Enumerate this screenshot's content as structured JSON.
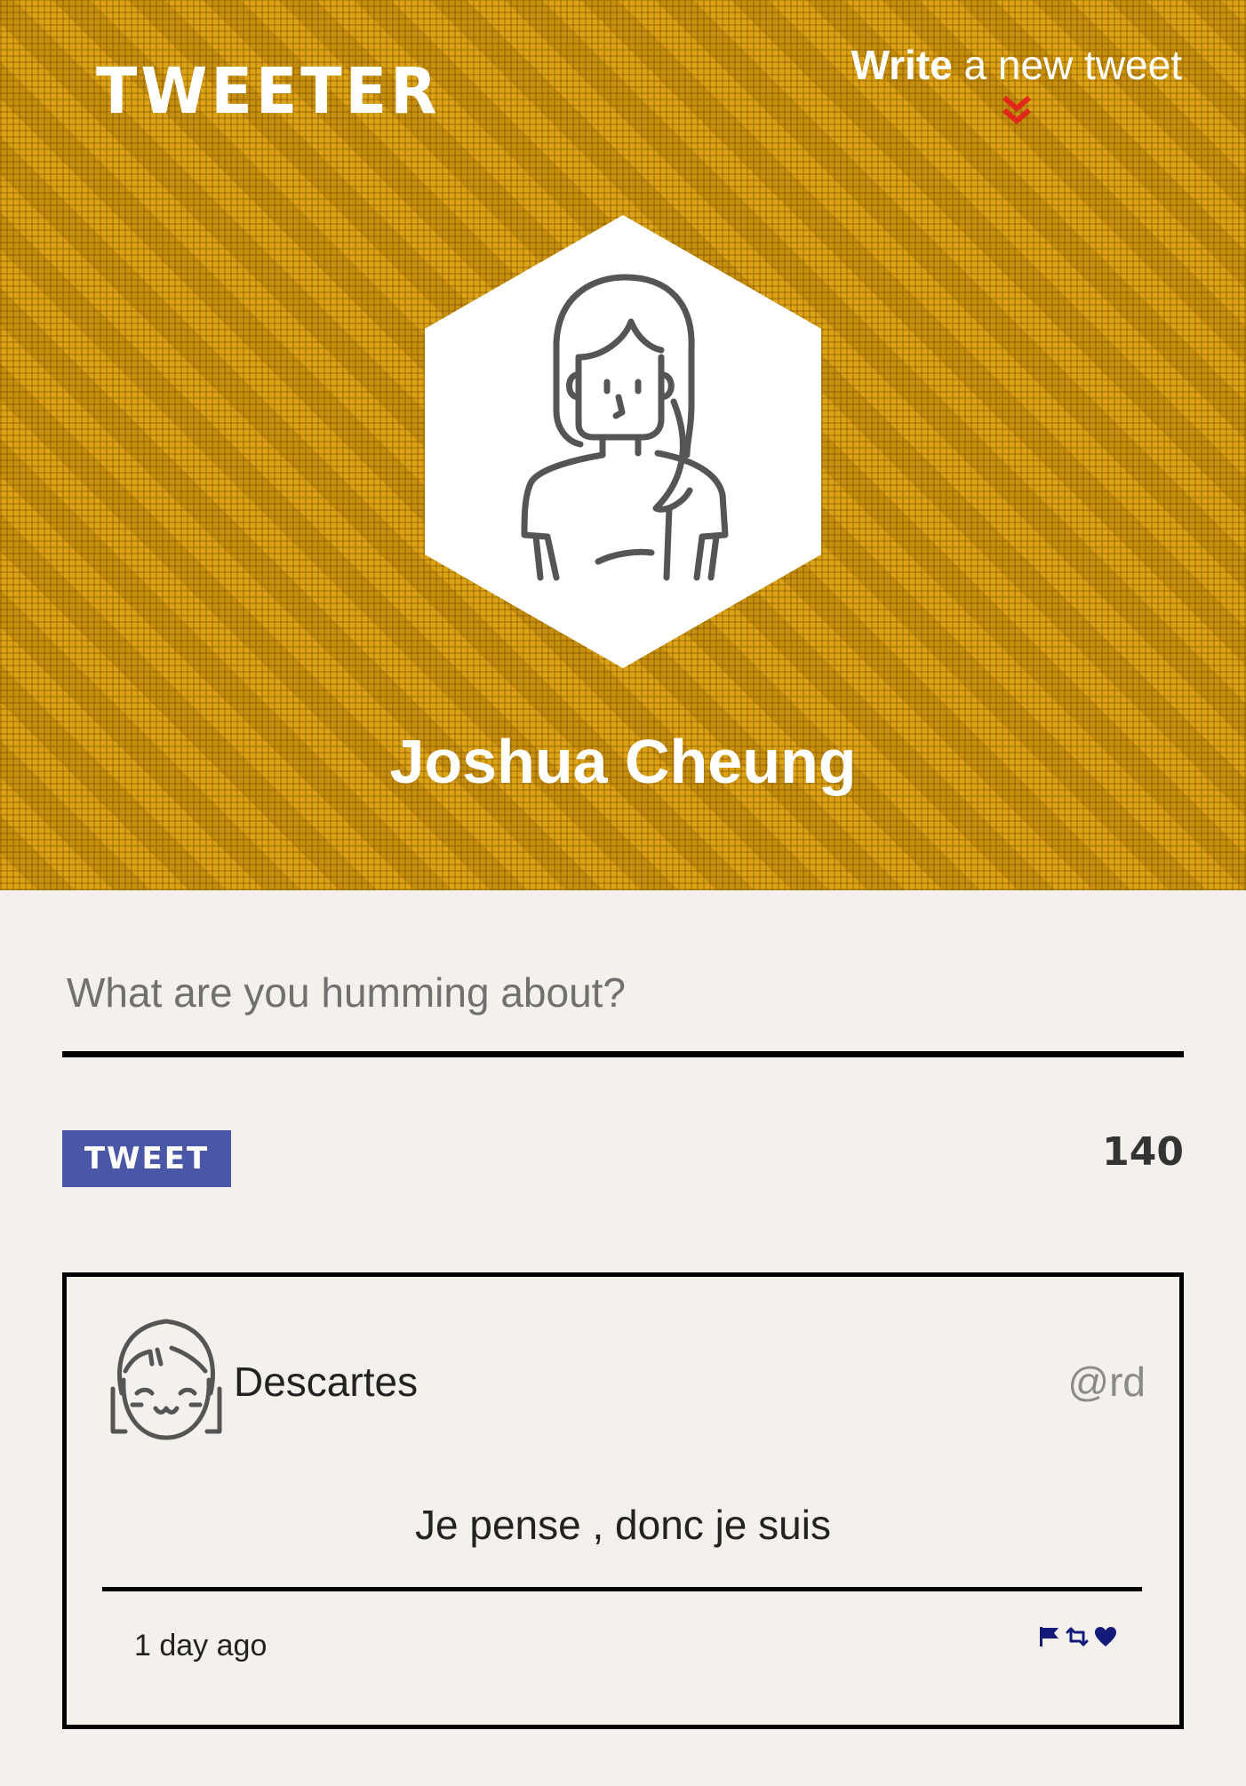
{
  "header": {
    "brand": "TWEETER",
    "compose_toggle": {
      "strong": "Write",
      "rest": " a new tweet",
      "icon": "double-chevron-down-icon",
      "icon_color": "#e0281a"
    },
    "background_color": "#d69b10"
  },
  "profile": {
    "name": "Joshua Cheung",
    "avatar_icon": "user-avatar-icon"
  },
  "composer": {
    "placeholder": "What are you humming about?",
    "value": "",
    "submit_label": "TWEET",
    "submit_color": "#4a56a6",
    "char_counter": "140"
  },
  "tweets": [
    {
      "author": "Descartes",
      "handle": "@rd",
      "avatar_icon": "girl-avatar-icon",
      "content": "Je pense , donc je suis",
      "time": "1 day ago",
      "actions": [
        "flag-icon",
        "retweet-icon",
        "heart-icon"
      ],
      "action_color": "#141a7a"
    }
  ]
}
